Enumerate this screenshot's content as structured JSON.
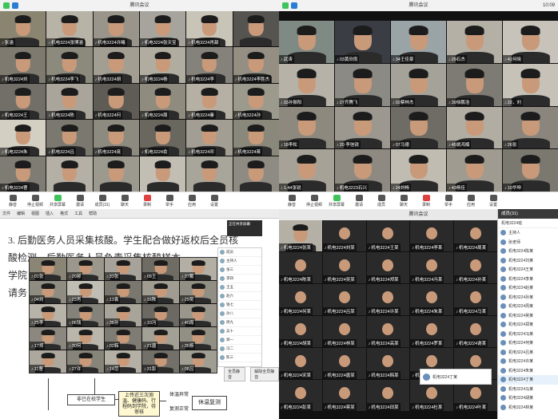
{
  "q1": {
    "title": "腾讯会议",
    "tiles": [
      {
        "label": "张涵",
        "c": "#8a8570"
      },
      {
        "label": "机电3224张博涵",
        "c": "#b7b3a6"
      },
      {
        "label": "机电3224许曦",
        "c": "#9a958a"
      },
      {
        "label": "机电3224张天宝",
        "c": "#a6a49c"
      },
      {
        "label": "机电3224肖甜",
        "c": "#c9c4b8"
      },
      {
        "label": "",
        "c": "#565451"
      },
      {
        "label": "机电3224刘",
        "c": "#7e7a6f"
      },
      {
        "label": "机电3224李飞",
        "c": "#8c8a7d"
      },
      {
        "label": "机电3224胡",
        "c": "#a39e92"
      },
      {
        "label": "机电3224杨",
        "c": "#b0ac9f"
      },
      {
        "label": "机电3224李",
        "c": "#85827b"
      },
      {
        "label": "机电3224李胜杰",
        "c": "#948f82"
      },
      {
        "label": "机电3224王",
        "c": "#716f68"
      },
      {
        "label": "机电3224陈",
        "c": "#a9a59a"
      },
      {
        "label": "机电3224何",
        "c": "#5f5c55"
      },
      {
        "label": "机电3224周",
        "c": "#8f8b7e"
      },
      {
        "label": "机电3224秦",
        "c": "#b5b0a3"
      },
      {
        "label": "机电3224孙",
        "c": "#9c998d"
      },
      {
        "label": "机电3224朱",
        "c": "#d3cfc3"
      },
      {
        "label": "机电3224吕",
        "c": "#7b786f"
      },
      {
        "label": "机电3224庞",
        "c": "#8d8a80"
      },
      {
        "label": "机电3224俞",
        "c": "#6a675f"
      },
      {
        "label": "机电3224邓",
        "c": "#a29e93"
      },
      {
        "label": "机电3224蒋",
        "c": "#8a877b"
      },
      {
        "label": "机电3224曹",
        "c": "#7f7c74"
      },
      {
        "label": "",
        "c": "#b4b0a5"
      },
      {
        "label": "",
        "c": "#9c998f"
      },
      {
        "label": "",
        "c": "#c2beb3"
      },
      {
        "label": "",
        "c": "#a8a59a"
      },
      {
        "label": "",
        "c": "#8e8b82"
      }
    ],
    "toolbar": [
      "静音",
      "停止视频",
      "共享屏幕",
      "邀请",
      "成员(31)",
      "聊天",
      "录制",
      "举手",
      "应用",
      "设置"
    ]
  },
  "q2": {
    "title": "腾讯会议",
    "clock": "10:09",
    "tiles": [
      {
        "label": "武涛",
        "c": "#7f8a84"
      },
      {
        "label": "03黄欣雨",
        "c": "#3a3d44"
      },
      {
        "label": "34王佳豪",
        "c": "#9aa3a6"
      },
      {
        "label": "29石杰",
        "c": "#b4b0a5"
      },
      {
        "label": "41何晓",
        "c": "#c7c3ba"
      },
      {
        "label": "33孙振阳",
        "c": "#b6b2a8"
      },
      {
        "label": "27齐腾飞",
        "c": "#8b8a84"
      },
      {
        "label": "02蔡林杰",
        "c": "#a5a29a"
      },
      {
        "label": "39徐鹏浩",
        "c": "#7e7b74"
      },
      {
        "label": "22，刘",
        "c": "#c6c2b8"
      },
      {
        "label": "18李松",
        "c": "#8d897f"
      },
      {
        "label": "20 李信锐",
        "c": "#9c9890"
      },
      {
        "label": "07马德",
        "c": "#6f6c65"
      },
      {
        "label": "45姚鸿楠",
        "c": "#b1ada3"
      },
      {
        "label": "26张",
        "c": "#8a867d"
      },
      {
        "label": "1.44张锐",
        "c": "#a6a297"
      },
      {
        "label": "机电3223石兴",
        "c": "#8e8a81"
      },
      {
        "label": "24刘畅",
        "c": "#c0bcb2"
      },
      {
        "label": "43杨佳",
        "c": "#9f9b91"
      },
      {
        "label": "10华坤",
        "c": "#7b7870"
      }
    ],
    "toolbar": [
      "静音",
      "停止视频",
      "共享屏幕",
      "邀请",
      "成员",
      "聊天",
      "录制",
      "举手",
      "应用",
      "设置"
    ]
  },
  "q3": {
    "doc_toolbar": [
      "文件",
      "编辑",
      "视图",
      "插入",
      "格式",
      "工具",
      "帮助"
    ],
    "lines": [
      "3. 后勤医务人员采集核酸。学生配合做好返校后全员核",
      "酸检测，后勤医务人员负责采集核酸样本",
      "学院",
      "请务"
    ],
    "flow": {
      "box1": "非已在校学生",
      "box2": "上传近三次测温、健康码、行程码到学院，待审核",
      "box3": "体温异常",
      "box4": "复测正常",
      "box5": "休温复测"
    },
    "embed_tiles": [
      {
        "label": "01张",
        "c": "#8a8574"
      },
      {
        "label": "20郝",
        "c": "#9b978c"
      },
      {
        "label": "33张",
        "c": "#a7a39a"
      },
      {
        "label": "09王",
        "c": "#6f6c64"
      },
      {
        "label": "37戴",
        "c": "#b3afa5"
      },
      {
        "label": "04刘",
        "c": "#8f8c82"
      },
      {
        "label": "23肖",
        "c": "#c0bdb4"
      },
      {
        "label": "13袁",
        "c": "#7a776f"
      },
      {
        "label": "16陈",
        "c": "#a09c92"
      },
      {
        "label": "29吴",
        "c": "#918e84"
      },
      {
        "label": "25李",
        "c": "#b7b3a9"
      },
      {
        "label": "06钱",
        "c": "#858279"
      },
      {
        "label": "38孙",
        "c": "#a8a49a"
      },
      {
        "label": "10冯",
        "c": "#6c6962"
      },
      {
        "label": "40周",
        "c": "#9a968c"
      },
      {
        "label": "17郑",
        "c": "#8c887f"
      },
      {
        "label": "30何",
        "c": "#bab6ac"
      },
      {
        "label": "02韩",
        "c": "#7f7c73"
      },
      {
        "label": "21唐",
        "c": "#a3a095"
      },
      {
        "label": "35杨",
        "c": "#928f85"
      },
      {
        "label": "11曹",
        "c": "#aca89e"
      },
      {
        "label": "27许",
        "c": "#878479"
      },
      {
        "label": "14范",
        "c": "#b4b0a6"
      },
      {
        "label": "31彭",
        "c": "#73706a"
      },
      {
        "label": "08吕",
        "c": "#a09d93"
      }
    ],
    "list": [
      "成员",
      "主持人",
      "张三",
      "李四",
      "王五",
      "赵六",
      "钱七",
      "孙八",
      "周九",
      "吴十",
      "郑一",
      "冯二",
      "陈三"
    ],
    "popup": "正在共享屏幕",
    "buttons": [
      "全员静音",
      "解除全员静音"
    ]
  },
  "q4": {
    "title": "腾讯会议",
    "tiles": [
      {
        "label": "机电3224张某",
        "c": "#b4b0a6"
      },
      {
        "label": "机电3224刘某",
        "c": "#2a2a2a",
        "avatar": true
      },
      {
        "label": "机电3224王某",
        "c": "#2a2a2a",
        "avatar": true
      },
      {
        "label": "机电3224李某",
        "c": "#2a2a2a",
        "avatar": true
      },
      {
        "label": "机电3224周某",
        "c": "#2a2a2a",
        "avatar": true
      },
      {
        "label": "机电3224陈某",
        "c": "#2a2a2a",
        "avatar": true
      },
      {
        "label": "机电3224吴某",
        "c": "#2a2a2a",
        "avatar": true
      },
      {
        "label": "机电3224郑某",
        "c": "#2a2a2a",
        "avatar": true
      },
      {
        "label": "机电3224冯某",
        "c": "#2a2a2a",
        "avatar": true
      },
      {
        "label": "机电3224孙某",
        "c": "#2a2a2a",
        "avatar": true
      },
      {
        "label": "机电3224何某",
        "c": "#2a2a2a",
        "avatar": true
      },
      {
        "label": "机电3224吕某",
        "c": "#2a2a2a",
        "avatar": true
      },
      {
        "label": "机电3224许某",
        "c": "#2a2a2a",
        "avatar": true
      },
      {
        "label": "机电3224朱某",
        "c": "#2a2a2a",
        "avatar": true
      },
      {
        "label": "机电3224马某",
        "c": "#2a2a2a",
        "avatar": true
      },
      {
        "label": "机电3224胡某",
        "c": "#2a2a2a",
        "avatar": true
      },
      {
        "label": "机电3224林某",
        "c": "#2a2a2a",
        "avatar": true
      },
      {
        "label": "机电3224高某",
        "c": "#2a2a2a",
        "avatar": true
      },
      {
        "label": "机电3224罗某",
        "c": "#2a2a2a",
        "avatar": true
      },
      {
        "label": "机电3224谢某",
        "c": "#2a2a2a",
        "avatar": true
      },
      {
        "label": "机电3224宋某",
        "c": "#2a2a2a",
        "avatar": true
      },
      {
        "label": "机电3224唐某",
        "c": "#2a2a2a",
        "avatar": true
      },
      {
        "label": "机电3224韩某",
        "c": "#2a2a2a",
        "avatar": true
      },
      {
        "label": "机电3224曹某",
        "c": "#2a2a2a",
        "avatar": true
      },
      {
        "label": "机电3224邓某",
        "c": "#2a2a2a",
        "avatar": true
      },
      {
        "label": "机电3224彭某",
        "c": "#2a2a2a",
        "avatar": true
      },
      {
        "label": "机电3224蒋某",
        "c": "#2a2a2a",
        "avatar": true
      },
      {
        "label": "机电3224田某",
        "c": "#2a2a2a",
        "avatar": true
      },
      {
        "label": "机电3224杜某",
        "c": "#2a2a2a",
        "avatar": true
      },
      {
        "label": "机电3224叶某",
        "c": "#2a2a2a",
        "avatar": true
      }
    ],
    "panel": {
      "head": "成员(31)",
      "sub": "机电3224班",
      "rows": [
        "主持人",
        "张老师",
        "机电3224陈某",
        "机电3224刘某",
        "机电3224王某",
        "机电3224李某",
        "机电3224赵某",
        "机电3224孙某",
        "机电3224周某",
        "机电3224吴某",
        "机电3224郑某",
        "机电3224冯某",
        "机电3224何某",
        "机电3224吕某",
        "机电3224许某",
        "机电3224朱某",
        "机电3224丁某",
        "机电3224马某",
        "机电3224胡某",
        "机电3224林某"
      ],
      "selected": 16
    },
    "chat": "机电3224丁某"
  },
  "colors": {
    "green": "#3fc45b",
    "red": "#e04040",
    "accent": "#2b7cd3"
  }
}
